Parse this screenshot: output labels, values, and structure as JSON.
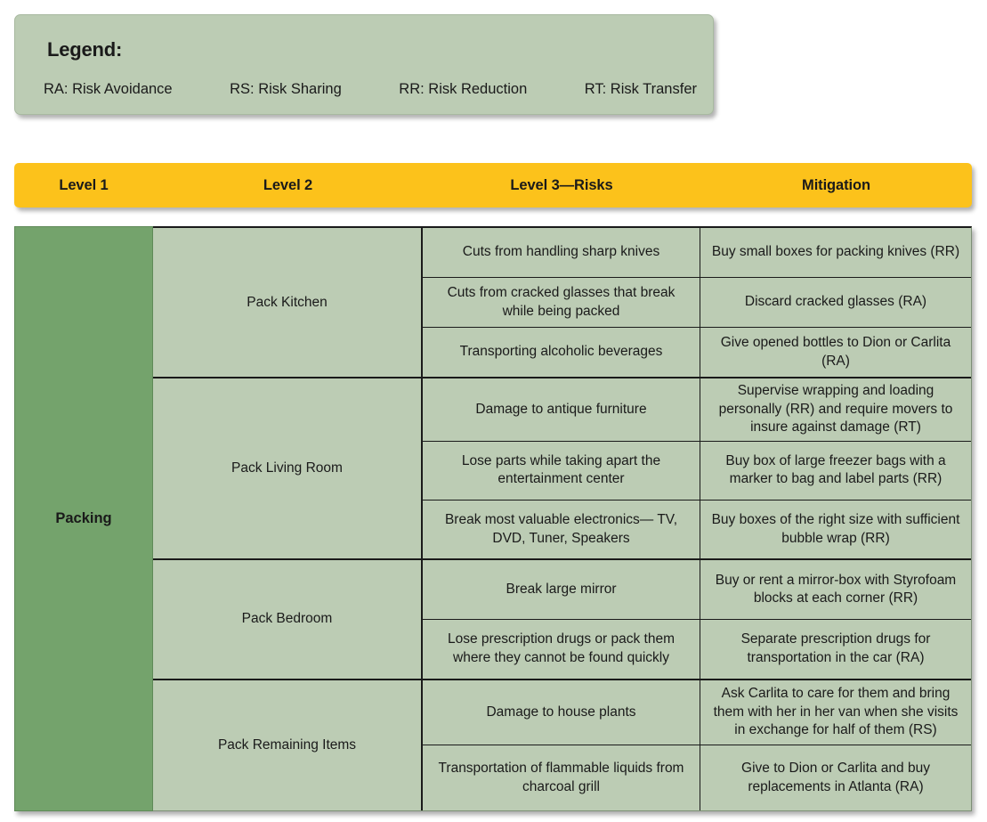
{
  "legend": {
    "title": "Legend:",
    "items": [
      "RA: Risk Avoidance",
      "RS: Risk Sharing",
      "RR: Risk Reduction",
      "RT: Risk Transfer"
    ]
  },
  "colors": {
    "header_yellow": "#fcc21b",
    "level1_green": "#74a36c",
    "cell_sage": "#bcccb4",
    "border_dark": "#1a1a1a",
    "text": "#1a1a1a"
  },
  "header": {
    "columns": [
      "Level 1",
      "Level 2",
      "Level 3—Risks",
      "Mitigation"
    ]
  },
  "matrix": {
    "level1": "Packing",
    "groups": [
      {
        "level2": "Pack Kitchen",
        "rows": [
          {
            "risk": "Cuts from handling sharp knives",
            "mitigation": "Buy small boxes for packing knives (RR)"
          },
          {
            "risk": "Cuts from cracked glasses that break while being packed",
            "mitigation": "Discard cracked glasses (RA)"
          },
          {
            "risk": "Transporting alcoholic beverages",
            "mitigation": "Give opened bottles to Dion or Carlita (RA)"
          }
        ]
      },
      {
        "level2": "Pack Living Room",
        "rows": [
          {
            "risk": "Damage to antique furniture",
            "mitigation": "Supervise wrapping and loading personally (RR) and require movers to insure against damage (RT)"
          },
          {
            "risk": "Lose parts while taking apart the entertainment center",
            "mitigation": "Buy box of large freezer bags with a marker to bag and label parts (RR)"
          },
          {
            "risk": "Break most valuable electronics— TV, DVD, Tuner, Speakers",
            "mitigation": "Buy boxes of the right size with sufficient bubble wrap (RR)"
          }
        ]
      },
      {
        "level2": "Pack Bedroom",
        "rows": [
          {
            "risk": "Break large mirror",
            "mitigation": "Buy or rent a mirror-box with Styrofoam blocks at each corner (RR)"
          },
          {
            "risk": "Lose prescription drugs or pack them where they cannot be found quickly",
            "mitigation": "Separate prescription drugs for transportation in the car (RA)"
          }
        ]
      },
      {
        "level2": "Pack Remaining Items",
        "rows": [
          {
            "risk": "Damage to house plants",
            "mitigation": "Ask Carlita to care for them and bring them with her in her van when she visits in exchange for half of them (RS)"
          },
          {
            "risk": "Transportation of flammable liquids from charcoal grill",
            "mitigation": "Give to Dion or Carlita and buy replacements in Atlanta (RA)"
          }
        ]
      }
    ]
  }
}
